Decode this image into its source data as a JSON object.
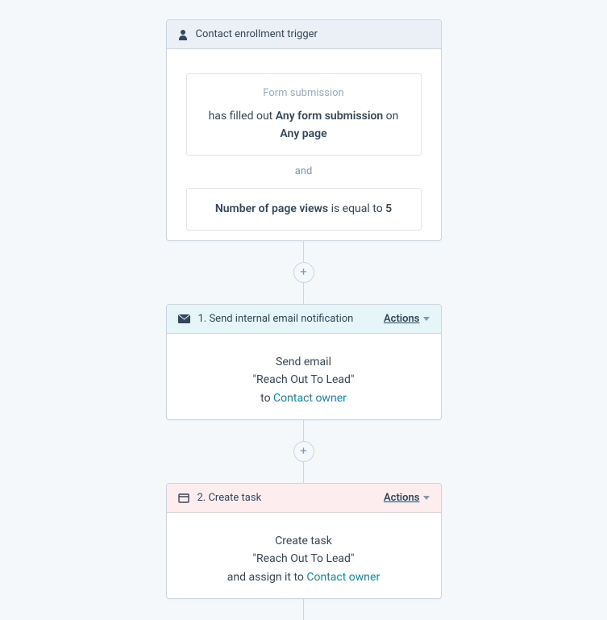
{
  "trigger": {
    "title": "Contact enrollment trigger",
    "filter1": {
      "label": "Form submission",
      "prefix": "has filled out ",
      "bold1": "Any form submission",
      "mid": " on ",
      "bold2": "Any page"
    },
    "and": "and",
    "filter2": {
      "bold1": "Number of page views",
      "mid": " is equal to ",
      "bold2": "5"
    }
  },
  "step1": {
    "title": "1. Send internal email notification",
    "actions_label": "Actions",
    "line1": "Send email",
    "line2": "Reach Out To Lead",
    "line3_prefix": "to ",
    "line3_link": "Contact owner"
  },
  "step2": {
    "title": "2. Create task",
    "actions_label": "Actions",
    "line1": "Create task",
    "line2": "Reach Out To Lead",
    "line3_prefix": "and assign it to ",
    "line3_link": "Contact owner"
  },
  "plus": "+"
}
